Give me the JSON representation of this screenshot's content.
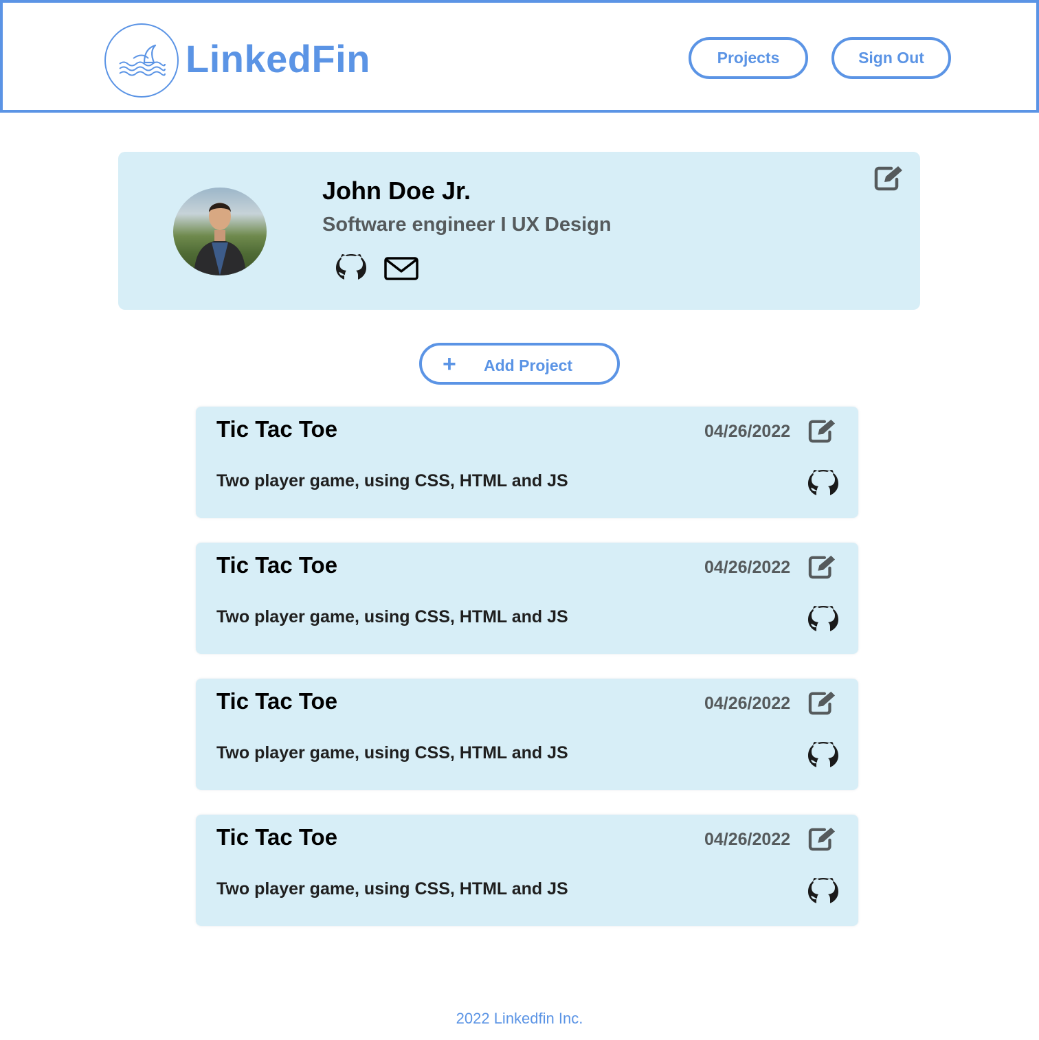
{
  "header": {
    "brand": "LinkedFin",
    "logo_icon": "shark-fin-waves-icon",
    "nav": [
      {
        "label": "Projects"
      },
      {
        "label": "Sign Out"
      }
    ]
  },
  "profile": {
    "name": "John Doe Jr.",
    "title": "Software engineer I UX Design",
    "icons": [
      "edit-icon",
      "github-icon",
      "mail-icon"
    ]
  },
  "add_project": {
    "icon": "plus-icon",
    "label": "Add Project"
  },
  "projects": [
    {
      "title": "Tic Tac Toe",
      "date": "04/26/2022",
      "description": "Two player game, using CSS, HTML and JS"
    },
    {
      "title": "Tic Tac Toe",
      "date": "04/26/2022",
      "description": "Two player game, using CSS, HTML and JS"
    },
    {
      "title": "Tic Tac Toe",
      "date": "04/26/2022",
      "description": "Two player game, using CSS, HTML and JS"
    },
    {
      "title": "Tic Tac Toe",
      "date": "04/26/2022",
      "description": "Two player game, using CSS, HTML and JS"
    }
  ],
  "footer": {
    "text": "2022 Linkedfin Inc."
  },
  "colors": {
    "accent": "#5b94e5",
    "card_bg": "#d7eef7",
    "muted_text": "#555a5c"
  }
}
